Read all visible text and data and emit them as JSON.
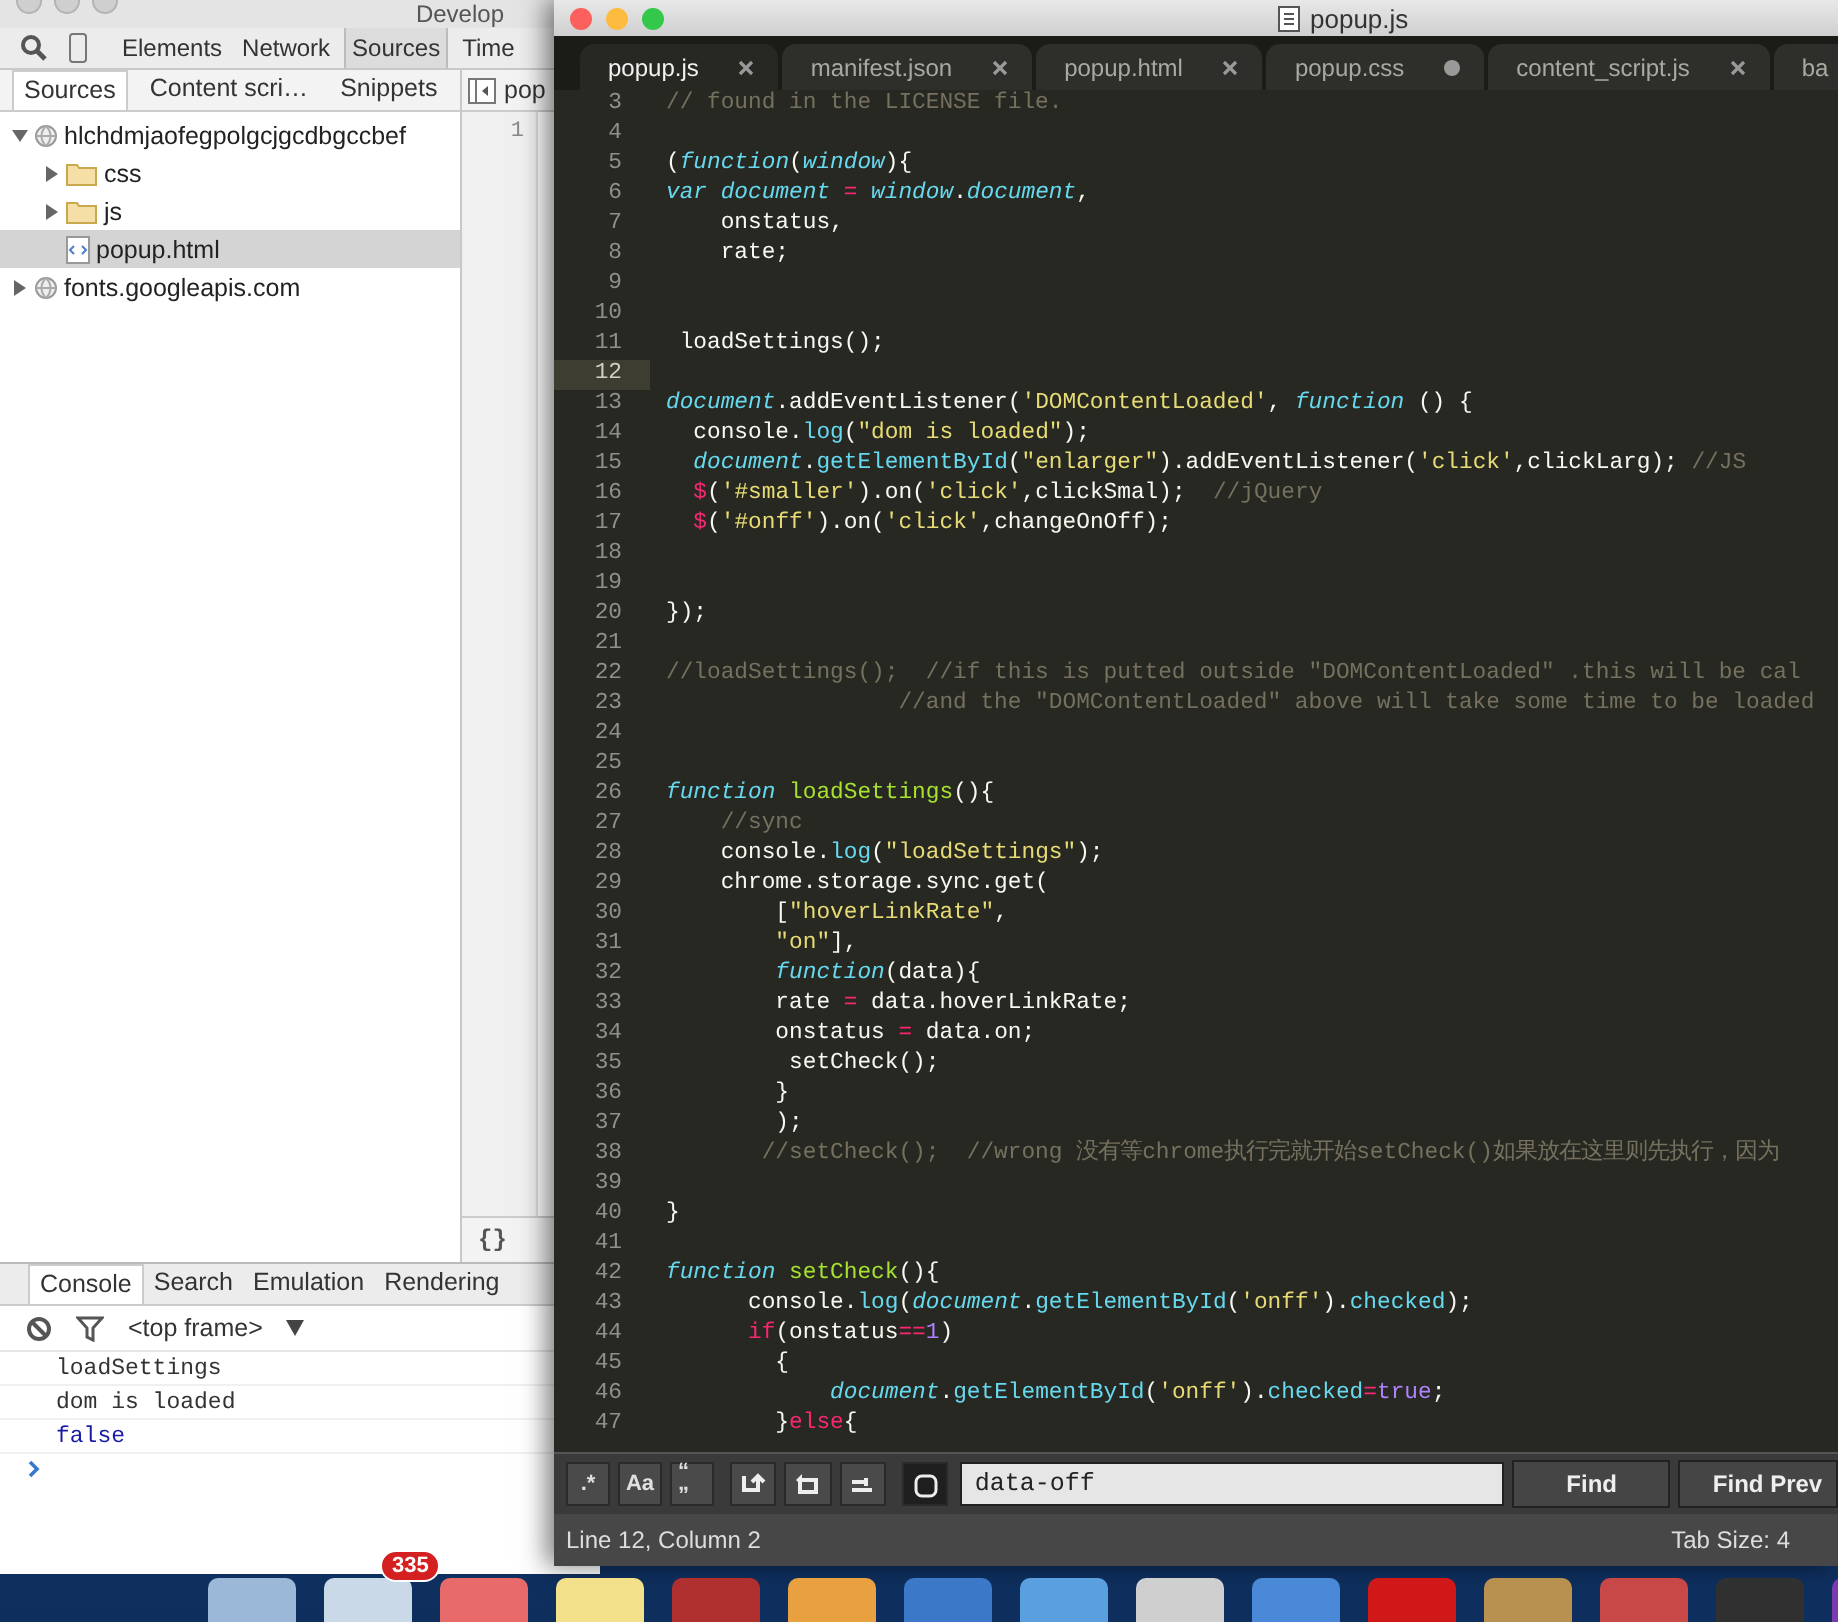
{
  "devtools": {
    "title": "Develop",
    "tabs": [
      {
        "label": "Elements",
        "selected": false
      },
      {
        "label": "Network",
        "selected": false
      },
      {
        "label": "Sources",
        "selected": true
      },
      {
        "label": "Time",
        "selected": false
      }
    ],
    "navigator_tabs": [
      {
        "label": "Sources",
        "selected": true
      },
      {
        "label": "Content scri…",
        "selected": false
      },
      {
        "label": "Snippets",
        "selected": false
      }
    ],
    "file_tab": "pop",
    "tree": [
      {
        "label": "hlchdmjaofegpolgcjgcdbgccbef",
        "kind": "domain",
        "expanded": true,
        "selected": false,
        "children": [
          {
            "label": "css",
            "kind": "folder",
            "expanded": false,
            "selected": false
          },
          {
            "label": "js",
            "kind": "folder",
            "expanded": false,
            "selected": false
          },
          {
            "label": "popup.html",
            "kind": "file",
            "selected": true
          }
        ]
      },
      {
        "label": "fonts.googleapis.com",
        "kind": "domain",
        "expanded": false,
        "selected": false
      }
    ],
    "line_numbers": [
      "1"
    ],
    "pretty_print": "{}",
    "drawer_tabs": [
      {
        "label": "Console",
        "selected": true
      },
      {
        "label": "Search",
        "selected": false
      },
      {
        "label": "Emulation",
        "selected": false
      },
      {
        "label": "Rendering",
        "selected": false
      }
    ],
    "context": "<top frame>",
    "messages": [
      {
        "text": "loadSettings",
        "kind": "log"
      },
      {
        "text": "dom is loaded",
        "kind": "log"
      },
      {
        "text": "false",
        "kind": "value"
      }
    ]
  },
  "editor": {
    "title": "popup.js",
    "tabs": [
      {
        "label": "popup.js",
        "selected": true,
        "dirty": false
      },
      {
        "label": "manifest.json",
        "selected": false,
        "dirty": false
      },
      {
        "label": "popup.html",
        "selected": false,
        "dirty": false
      },
      {
        "label": "popup.css",
        "selected": false,
        "dirty": true
      },
      {
        "label": "content_script.js",
        "selected": false,
        "dirty": false
      },
      {
        "label": "ba",
        "selected": false
      }
    ],
    "lines": [
      {
        "number": "3",
        "current": false,
        "tokens": [
          {
            "kind": "cmt",
            "text": "// found in the LICENSE file."
          }
        ]
      },
      {
        "number": "4",
        "current": false
      },
      {
        "number": "5",
        "current": false,
        "tokens": [
          {
            "kind": "p",
            "text": "("
          },
          {
            "kind": "kw",
            "text": "function"
          },
          {
            "kind": "p",
            "text": "("
          },
          {
            "kind": "kw",
            "text": "window"
          },
          {
            "kind": "p",
            "text": "){"
          }
        ]
      },
      {
        "number": "6",
        "current": false,
        "tokens": [
          {
            "kind": "kw",
            "text": "var document"
          },
          {
            "kind": "op",
            "text": " = "
          },
          {
            "kind": "kw",
            "text": "window"
          },
          {
            "kind": "p",
            "text": "."
          },
          {
            "kind": "kw",
            "text": "document"
          },
          {
            "kind": "p",
            "text": ","
          }
        ]
      },
      {
        "number": "7",
        "current": false,
        "tokens": [
          {
            "kind": "p",
            "text": "    onstatus,"
          }
        ]
      },
      {
        "number": "8",
        "current": false,
        "tokens": [
          {
            "kind": "p",
            "text": "    rate;"
          }
        ]
      },
      {
        "number": "9",
        "current": false
      },
      {
        "number": "10",
        "current": false
      },
      {
        "number": "11",
        "current": false,
        "tokens": [
          {
            "kind": "p",
            "text": " loadSettings();"
          }
        ]
      },
      {
        "number": "12",
        "current": true
      },
      {
        "number": "13",
        "current": false,
        "tokens": [
          {
            "kind": "kw",
            "text": "document"
          },
          {
            "kind": "p",
            "text": ".addEventListener("
          },
          {
            "kind": "str",
            "text": "'DOMContentLoaded'"
          },
          {
            "kind": "p",
            "text": ", "
          },
          {
            "kind": "kw",
            "text": "function"
          },
          {
            "kind": "p",
            "text": " () {"
          }
        ]
      },
      {
        "number": "14",
        "current": false,
        "tokens": [
          {
            "kind": "p",
            "text": "  console."
          },
          {
            "kind": "fn",
            "text": "log"
          },
          {
            "kind": "p",
            "text": "("
          },
          {
            "kind": "str",
            "text": "\"dom is loaded\""
          },
          {
            "kind": "p",
            "text": ");"
          }
        ]
      },
      {
        "number": "15",
        "current": false,
        "tokens": [
          {
            "kind": "kw",
            "text": "  document"
          },
          {
            "kind": "p",
            "text": "."
          },
          {
            "kind": "fn",
            "text": "getElementById"
          },
          {
            "kind": "p",
            "text": "("
          },
          {
            "kind": "str",
            "text": "\"enlarger\""
          },
          {
            "kind": "p",
            "text": ").addEventListener("
          },
          {
            "kind": "str",
            "text": "'click'"
          },
          {
            "kind": "p",
            "text": ",clickLarg); "
          },
          {
            "kind": "cmt",
            "text": "//JS"
          }
        ]
      },
      {
        "number": "16",
        "current": false,
        "tokens": [
          {
            "kind": "op",
            "text": "  $"
          },
          {
            "kind": "p",
            "text": "("
          },
          {
            "kind": "str",
            "text": "'#smaller'"
          },
          {
            "kind": "p",
            "text": ").on("
          },
          {
            "kind": "str",
            "text": "'click'"
          },
          {
            "kind": "p",
            "text": ",clickSmal);  "
          },
          {
            "kind": "cmt",
            "text": "//jQuery"
          }
        ]
      },
      {
        "number": "17",
        "current": false,
        "tokens": [
          {
            "kind": "op",
            "text": "  $"
          },
          {
            "kind": "p",
            "text": "("
          },
          {
            "kind": "str",
            "text": "'#onff'"
          },
          {
            "kind": "p",
            "text": ").on("
          },
          {
            "kind": "str",
            "text": "'click'"
          },
          {
            "kind": "p",
            "text": ",changeOnOff);"
          }
        ]
      },
      {
        "number": "18",
        "current": false
      },
      {
        "number": "19",
        "current": false
      },
      {
        "number": "20",
        "current": false,
        "tokens": [
          {
            "kind": "p",
            "text": "});"
          }
        ]
      },
      {
        "number": "21",
        "current": false
      },
      {
        "number": "22",
        "current": false,
        "tokens": [
          {
            "kind": "cmt",
            "text": "//loadSettings();  //if this is putted outside \"DOMContentLoaded\" .this will be cal"
          }
        ]
      },
      {
        "number": "23",
        "current": false,
        "tokens": [
          {
            "kind": "cmt",
            "text": "                 //and the \"DOMContentLoaded\" above will take some time to be loaded"
          }
        ]
      },
      {
        "number": "24",
        "current": false
      },
      {
        "number": "25",
        "current": false
      },
      {
        "number": "26",
        "current": false,
        "tokens": [
          {
            "kind": "kw",
            "text": "function"
          },
          {
            "kind": "def",
            "text": " loadSettings"
          },
          {
            "kind": "p",
            "text": "(){"
          }
        ]
      },
      {
        "number": "27",
        "current": false,
        "tokens": [
          {
            "kind": "cmt",
            "text": "    //sync"
          }
        ]
      },
      {
        "number": "28",
        "current": false,
        "tokens": [
          {
            "kind": "p",
            "text": "    console."
          },
          {
            "kind": "fn",
            "text": "log"
          },
          {
            "kind": "p",
            "text": "("
          },
          {
            "kind": "str",
            "text": "\"loadSettings\""
          },
          {
            "kind": "p",
            "text": ");"
          }
        ]
      },
      {
        "number": "29",
        "current": false,
        "tokens": [
          {
            "kind": "p",
            "text": "    chrome.storage.sync.get("
          }
        ]
      },
      {
        "number": "30",
        "current": false,
        "tokens": [
          {
            "kind": "p",
            "text": "        ["
          },
          {
            "kind": "str",
            "text": "\"hoverLinkRate\""
          },
          {
            "kind": "p",
            "text": ","
          }
        ]
      },
      {
        "number": "31",
        "current": false,
        "tokens": [
          {
            "kind": "str",
            "text": "        \"on\""
          },
          {
            "kind": "p",
            "text": "],"
          }
        ]
      },
      {
        "number": "32",
        "current": false,
        "tokens": [
          {
            "kind": "kw",
            "text": "        function"
          },
          {
            "kind": "p",
            "text": "(data){"
          }
        ]
      },
      {
        "number": "33",
        "current": false,
        "tokens": [
          {
            "kind": "p",
            "text": "        rate "
          },
          {
            "kind": "op",
            "text": "="
          },
          {
            "kind": "p",
            "text": " data.hoverLinkRate;"
          }
        ]
      },
      {
        "number": "34",
        "current": false,
        "tokens": [
          {
            "kind": "p",
            "text": "        onstatus "
          },
          {
            "kind": "op",
            "text": "="
          },
          {
            "kind": "p",
            "text": " data.on;"
          }
        ]
      },
      {
        "number": "35",
        "current": false,
        "tokens": [
          {
            "kind": "p",
            "text": "         setCheck();"
          }
        ]
      },
      {
        "number": "36",
        "current": false,
        "tokens": [
          {
            "kind": "p",
            "text": "        }"
          }
        ]
      },
      {
        "number": "37",
        "current": false,
        "tokens": [
          {
            "kind": "p",
            "text": "        );"
          }
        ]
      },
      {
        "number": "38",
        "current": false,
        "tokens": [
          {
            "kind": "cmt",
            "text": "       //setCheck();  //wrong 没有等chrome执行完就开始setCheck()如果放在这里则先执行，因为"
          }
        ]
      },
      {
        "number": "39",
        "current": false
      },
      {
        "number": "40",
        "current": false,
        "tokens": [
          {
            "kind": "p",
            "text": "}"
          }
        ]
      },
      {
        "number": "41",
        "current": false
      },
      {
        "number": "42",
        "current": false,
        "tokens": [
          {
            "kind": "kw",
            "text": "function"
          },
          {
            "kind": "def",
            "text": " setCheck"
          },
          {
            "kind": "p",
            "text": "(){"
          }
        ]
      },
      {
        "number": "43",
        "current": false,
        "tokens": [
          {
            "kind": "p",
            "text": "      console."
          },
          {
            "kind": "fn",
            "text": "log"
          },
          {
            "kind": "p",
            "text": "("
          },
          {
            "kind": "kw",
            "text": "document"
          },
          {
            "kind": "p",
            "text": "."
          },
          {
            "kind": "fn",
            "text": "getElementById"
          },
          {
            "kind": "p",
            "text": "("
          },
          {
            "kind": "str",
            "text": "'onff'"
          },
          {
            "kind": "p",
            "text": ")."
          },
          {
            "kind": "fn",
            "text": "checked"
          },
          {
            "kind": "p",
            "text": ");"
          }
        ]
      },
      {
        "number": "44",
        "current": false,
        "tokens": [
          {
            "kind": "op",
            "text": "      if"
          },
          {
            "kind": "p",
            "text": "(onstatus"
          },
          {
            "kind": "op",
            "text": "=="
          },
          {
            "kind": "num",
            "text": "1"
          },
          {
            "kind": "p",
            "text": ")"
          }
        ]
      },
      {
        "number": "45",
        "current": false,
        "tokens": [
          {
            "kind": "p",
            "text": "        {"
          }
        ]
      },
      {
        "number": "46",
        "current": false,
        "tokens": [
          {
            "kind": "kw",
            "text": "            document"
          },
          {
            "kind": "p",
            "text": "."
          },
          {
            "kind": "fn",
            "text": "getElementById"
          },
          {
            "kind": "p",
            "text": "("
          },
          {
            "kind": "str",
            "text": "'onff'"
          },
          {
            "kind": "p",
            "text": ")."
          },
          {
            "kind": "fn",
            "text": "checked"
          },
          {
            "kind": "op",
            "text": "="
          },
          {
            "kind": "num",
            "text": "true"
          },
          {
            "kind": "p",
            "text": ";"
          }
        ]
      },
      {
        "number": "47",
        "current": false,
        "tokens": [
          {
            "kind": "p",
            "text": "        }"
          },
          {
            "kind": "op",
            "text": "else"
          },
          {
            "kind": "p",
            "text": "{"
          }
        ]
      }
    ],
    "find": {
      "options": [
        {
          "kind": "text",
          "label": ".*",
          "on": false
        },
        {
          "kind": "text",
          "label": "Aa",
          "on": false
        },
        {
          "kind": "text",
          "label": "“ ”",
          "on": false
        },
        {
          "kind": "wrap",
          "on": false
        },
        {
          "kind": "selection",
          "on": false
        },
        {
          "kind": "highlight",
          "on": false
        },
        {
          "kind": "context",
          "on": true
        }
      ],
      "value": "data-off",
      "buttons": [
        "Find",
        "Find Prev"
      ]
    },
    "status": {
      "position": "Line 12, Column 2",
      "tab_size": "Tab Size: 4"
    }
  },
  "dock": {
    "badge": "335"
  }
}
